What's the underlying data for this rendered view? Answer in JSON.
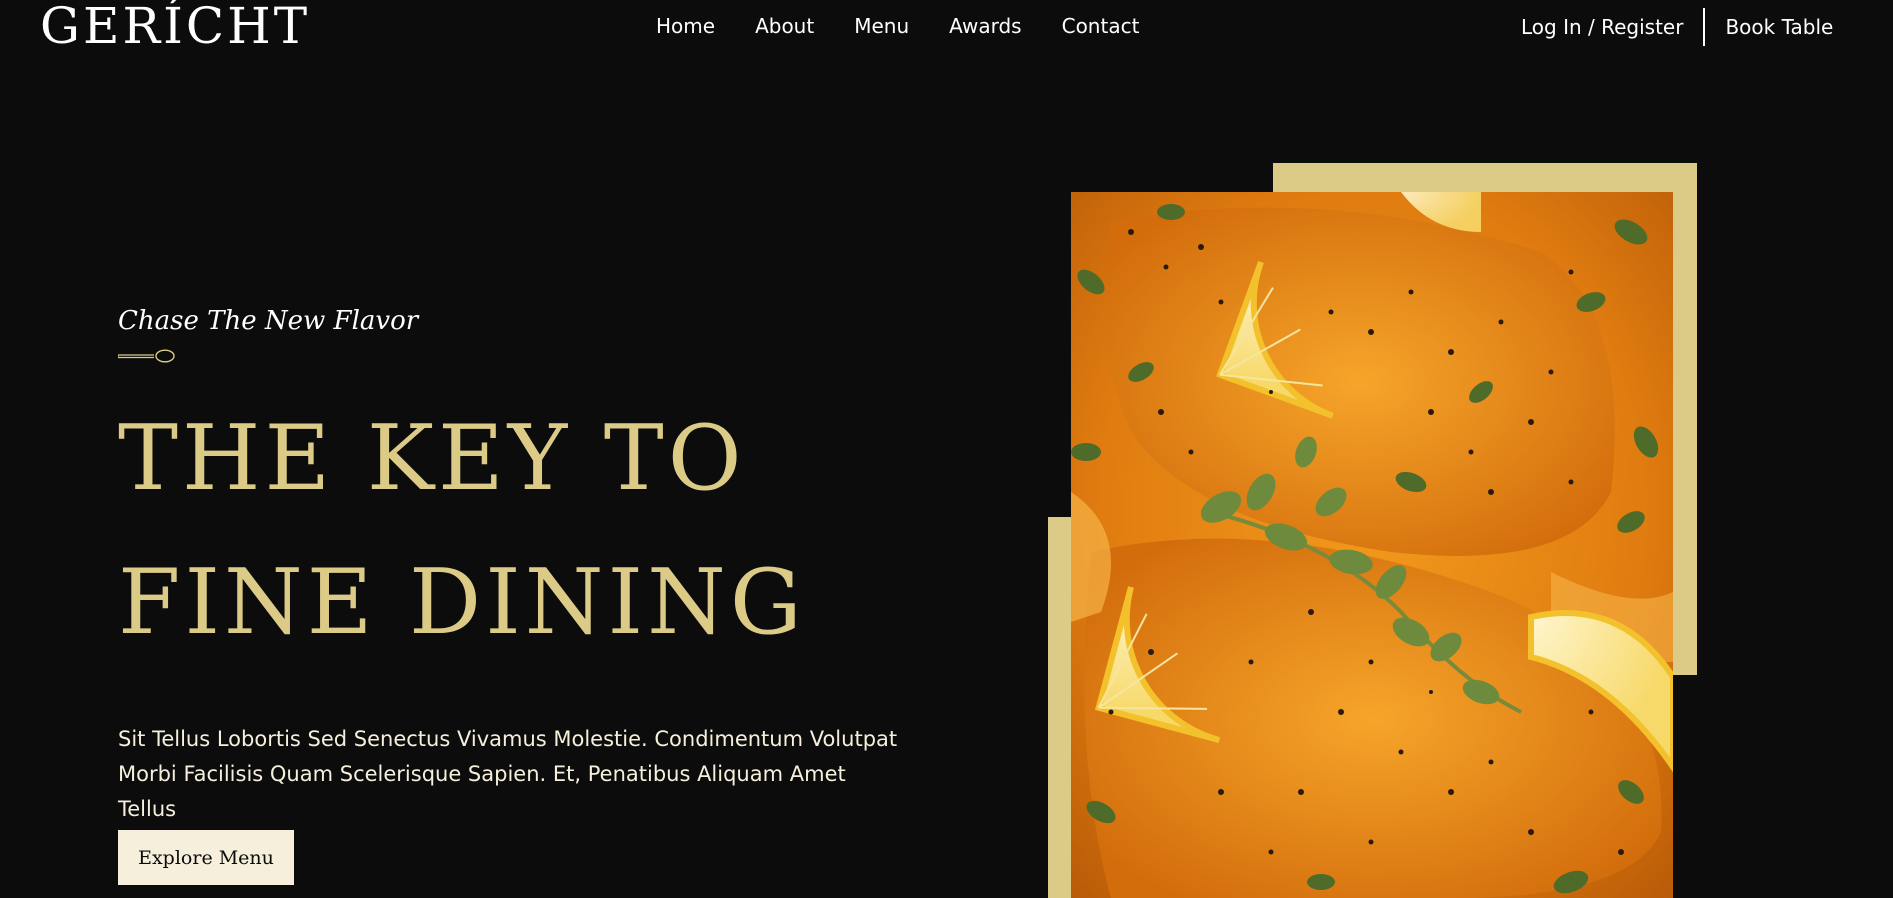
{
  "brand": {
    "logo_text": "GERÍCHT"
  },
  "nav": {
    "links": [
      "Home",
      "About",
      "Menu",
      "Awards",
      "Contact"
    ],
    "login_label": "Log In / Register",
    "book_label": "Book Table"
  },
  "hero": {
    "subtitle": "Chase The New Flavor",
    "headline_line1": "THE KEY TO",
    "headline_line2": "FINE DINING",
    "description_line1": "Sit Tellus Lobortis Sed Senectus Vivamus Molestie. Condimentum Volutpat",
    "description_line2": "Morbi Facilisis Quam Scelerisque Sapien. Et, Penatibus Aliquam Amet Tellus",
    "cta_label": "Explore Menu",
    "image_icon": "salmon-dish-photo"
  },
  "colors": {
    "background": "#0c0c0c",
    "gold": "#dcca87",
    "cream": "#f5efdb",
    "white": "#ffffff"
  }
}
